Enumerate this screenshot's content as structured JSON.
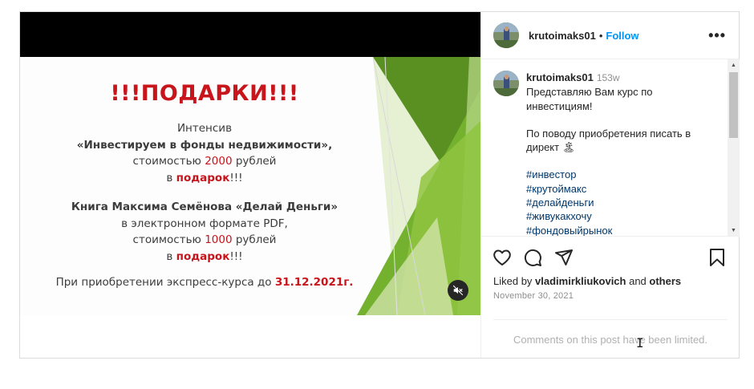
{
  "post": {
    "username": "krutoimaks01",
    "separator": "•",
    "follow_label": "Follow",
    "more_label": "•••"
  },
  "slide": {
    "title": "!!!ПОДАРКИ!!!",
    "block1": {
      "line1": "Интенсив",
      "line2": "«Инвестируем в фонды недвижимости»,",
      "line3_pre": "стоимостью ",
      "line3_num": "2000",
      "line3_post": " рублей",
      "line4_pre": "в ",
      "line4_hl": "подарок",
      "line4_post": "!!!"
    },
    "block2": {
      "line1": "Книга Максима Семёнова «Делай Деньги»",
      "line2": "в электронном формате PDF,",
      "line3_pre": "стоимостью ",
      "line3_num": "1000",
      "line3_post": " рублей",
      "line4_pre": "в ",
      "line4_hl": "подарок",
      "line4_post": "!!!"
    },
    "footer_pre": "При приобретении экспресс-курса до ",
    "footer_date": "31.12.2021г."
  },
  "media": {
    "mute_icon": "speaker-muted-icon"
  },
  "caption": {
    "username": "krutoimaks01",
    "time": "153w",
    "line1": "Представляю Вам курс по инвестициям!",
    "line2": "По поводу приобретения писать в директ 🏝",
    "hashtags": [
      "#инвестор",
      "#крутоймакс",
      "#делайденьги",
      "#живукакхочу",
      "#фондовыйрынок"
    ]
  },
  "actions": {
    "icons": [
      "heart-icon",
      "comment-icon",
      "share-icon",
      "bookmark-icon"
    ]
  },
  "likes": {
    "prefix": "Liked by ",
    "user": "vladimirkliukovich",
    "middle": " and ",
    "others": "others"
  },
  "date": "November 30, 2021",
  "comments_limited": "Comments on this post have been limited.",
  "colors": {
    "follow": "#0095f6",
    "hashtag": "#00376b",
    "slide_red": "#c8141b",
    "slide_green": "#6fa52b"
  }
}
